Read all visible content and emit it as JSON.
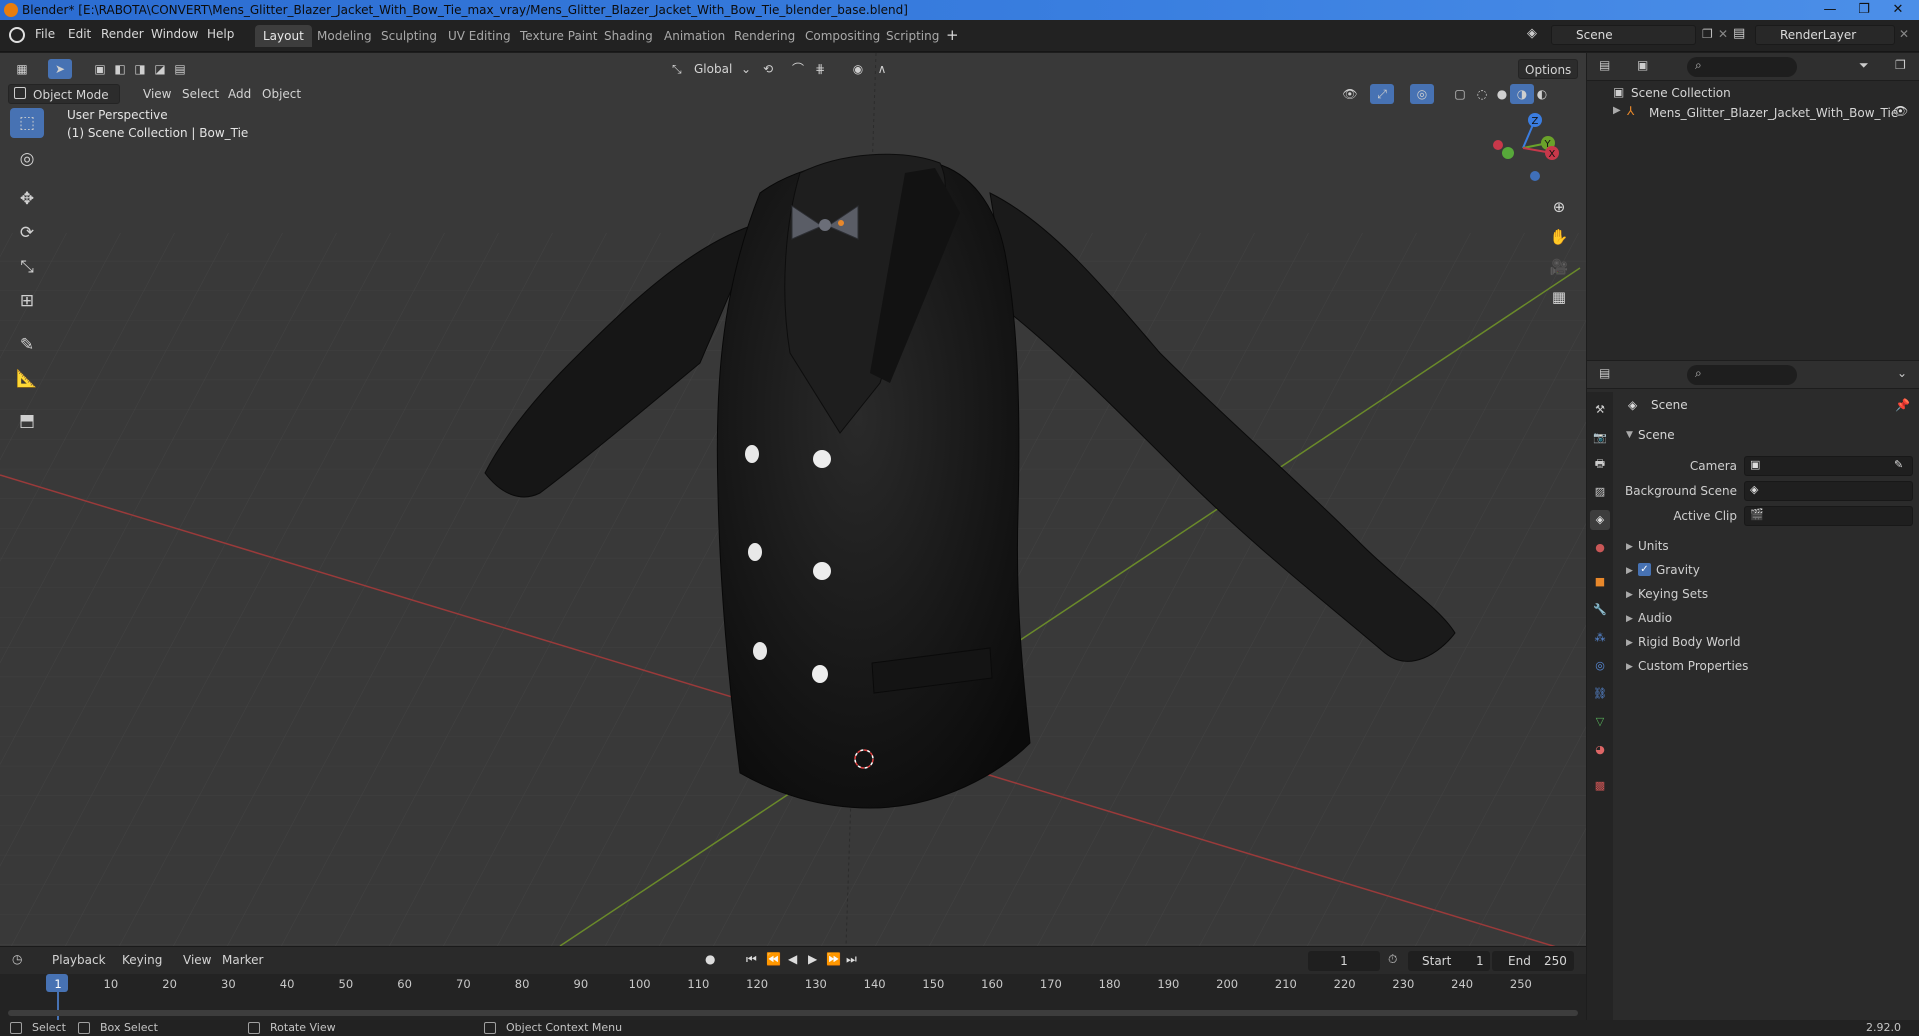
{
  "window": {
    "title": "Blender* [E:\\RABOTA\\CONVERT\\Mens_Glitter_Blazer_Jacket_With_Bow_Tie_max_vray/Mens_Glitter_Blazer_Jacket_With_Bow_Tie_blender_base.blend]",
    "controls": [
      "—",
      "❐",
      "✕"
    ]
  },
  "menu": {
    "items": [
      "File",
      "Edit",
      "Render",
      "Window",
      "Help"
    ],
    "workspaces": [
      "Layout",
      "Modeling",
      "Sculpting",
      "UV Editing",
      "Texture Paint",
      "Shading",
      "Animation",
      "Rendering",
      "Compositing",
      "Scripting"
    ],
    "active_workspace": "Layout",
    "add_workspace": "+",
    "scene_name": "Scene",
    "view_layer": "RenderLayer"
  },
  "viewport": {
    "mode": "Object Mode",
    "menus": [
      "View",
      "Select",
      "Add",
      "Object"
    ],
    "transform_orientation": "Global",
    "options_label": "Options",
    "overlay_text_1": "User Perspective",
    "overlay_text_2": "(1) Scene Collection | Bow_Tie",
    "gizmo_axes": [
      "Z",
      "Y",
      "X"
    ],
    "colors": {
      "background": "#393939",
      "x_axis": "#9a3a3a",
      "y_axis": "#6a8a2a",
      "active": "#4772b3"
    }
  },
  "toolbar": {
    "tools": [
      "select-box",
      "cursor",
      "move",
      "rotate",
      "scale",
      "transform",
      "annotate",
      "measure",
      "add-cube"
    ],
    "active_tool": "select-box"
  },
  "outliner": {
    "root": "Scene Collection",
    "items": [
      {
        "name": "Mens_Glitter_Blazer_Jacket_With_Bow_Tie"
      }
    ]
  },
  "properties": {
    "context": "Scene",
    "section": "Scene",
    "fields": [
      {
        "label": "Camera",
        "value": ""
      },
      {
        "label": "Background Scene",
        "value": ""
      },
      {
        "label": "Active Clip",
        "value": ""
      }
    ],
    "panels": [
      "Units",
      "Gravity",
      "Keying Sets",
      "Audio",
      "Rigid Body World",
      "Custom Properties"
    ],
    "gravity_enabled": true
  },
  "timeline": {
    "menus": [
      "Playback",
      "Keying",
      "View",
      "Marker"
    ],
    "current_frame": "1",
    "start_label": "Start",
    "start": "1",
    "end_label": "End",
    "end": "250",
    "ticks": [
      "1",
      "10",
      "20",
      "30",
      "40",
      "50",
      "60",
      "70",
      "80",
      "90",
      "100",
      "110",
      "120",
      "130",
      "140",
      "150",
      "160",
      "170",
      "180",
      "190",
      "200",
      "210",
      "220",
      "230",
      "240",
      "250"
    ]
  },
  "status": {
    "select": "Select",
    "box_select": "Box Select",
    "rotate_view": "Rotate View",
    "context_menu": "Object Context Menu",
    "version": "2.92.0"
  }
}
